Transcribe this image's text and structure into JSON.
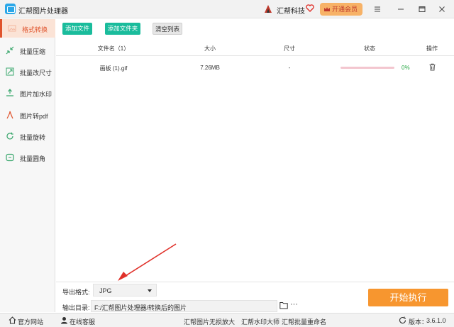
{
  "titlebar": {
    "app_title": "汇帮图片处理器",
    "brand_name": "汇帮科技",
    "vip_label": "开通会员"
  },
  "sidebar": {
    "items": [
      {
        "label": "格式转换",
        "icon": "image-convert-icon",
        "active": true
      },
      {
        "label": "批量压缩",
        "icon": "compress-icon",
        "active": false
      },
      {
        "label": "批量改尺寸",
        "icon": "resize-icon",
        "active": false
      },
      {
        "label": "图片加水印",
        "icon": "watermark-icon",
        "active": false
      },
      {
        "label": "图片转pdf",
        "icon": "pdf-icon",
        "active": false
      },
      {
        "label": "批量旋转",
        "icon": "rotate-icon",
        "active": false
      },
      {
        "label": "批量圆角",
        "icon": "round-corner-icon",
        "active": false
      }
    ]
  },
  "toolbar": {
    "add_file": "添加文件",
    "add_folder": "添加文件夹",
    "clear_list": "清空列表"
  },
  "table": {
    "headers": {
      "filename": "文件名（1）",
      "size": "大小",
      "dimensions": "尺寸",
      "status": "状态",
      "actions": "操作"
    },
    "rows": [
      {
        "filename": "画板 (1).gif",
        "size": "7.26MB",
        "dimensions": "-",
        "progress": 0,
        "percent": "0%"
      }
    ]
  },
  "settings": {
    "format_label": "导出格式:",
    "format_value": "JPG",
    "outdir_label": "输出目录:",
    "outdir_value": "F:/汇帮图片处理器/转换后的图片",
    "more": "···",
    "start_button": "开始执行"
  },
  "statusbar": {
    "website": "官方网站",
    "service": "在线客服",
    "link1": "汇帮图片无损放大",
    "link2": "汇帮水印大师",
    "link3": "汇帮批量重命名",
    "version_label": "版本：",
    "version_value": "3.6.1.0"
  },
  "colors": {
    "accent": "#e0532c",
    "teal": "#1abc9c",
    "orange": "#f7962f",
    "vip": "#f7b267",
    "arrow": "#e0312a"
  }
}
